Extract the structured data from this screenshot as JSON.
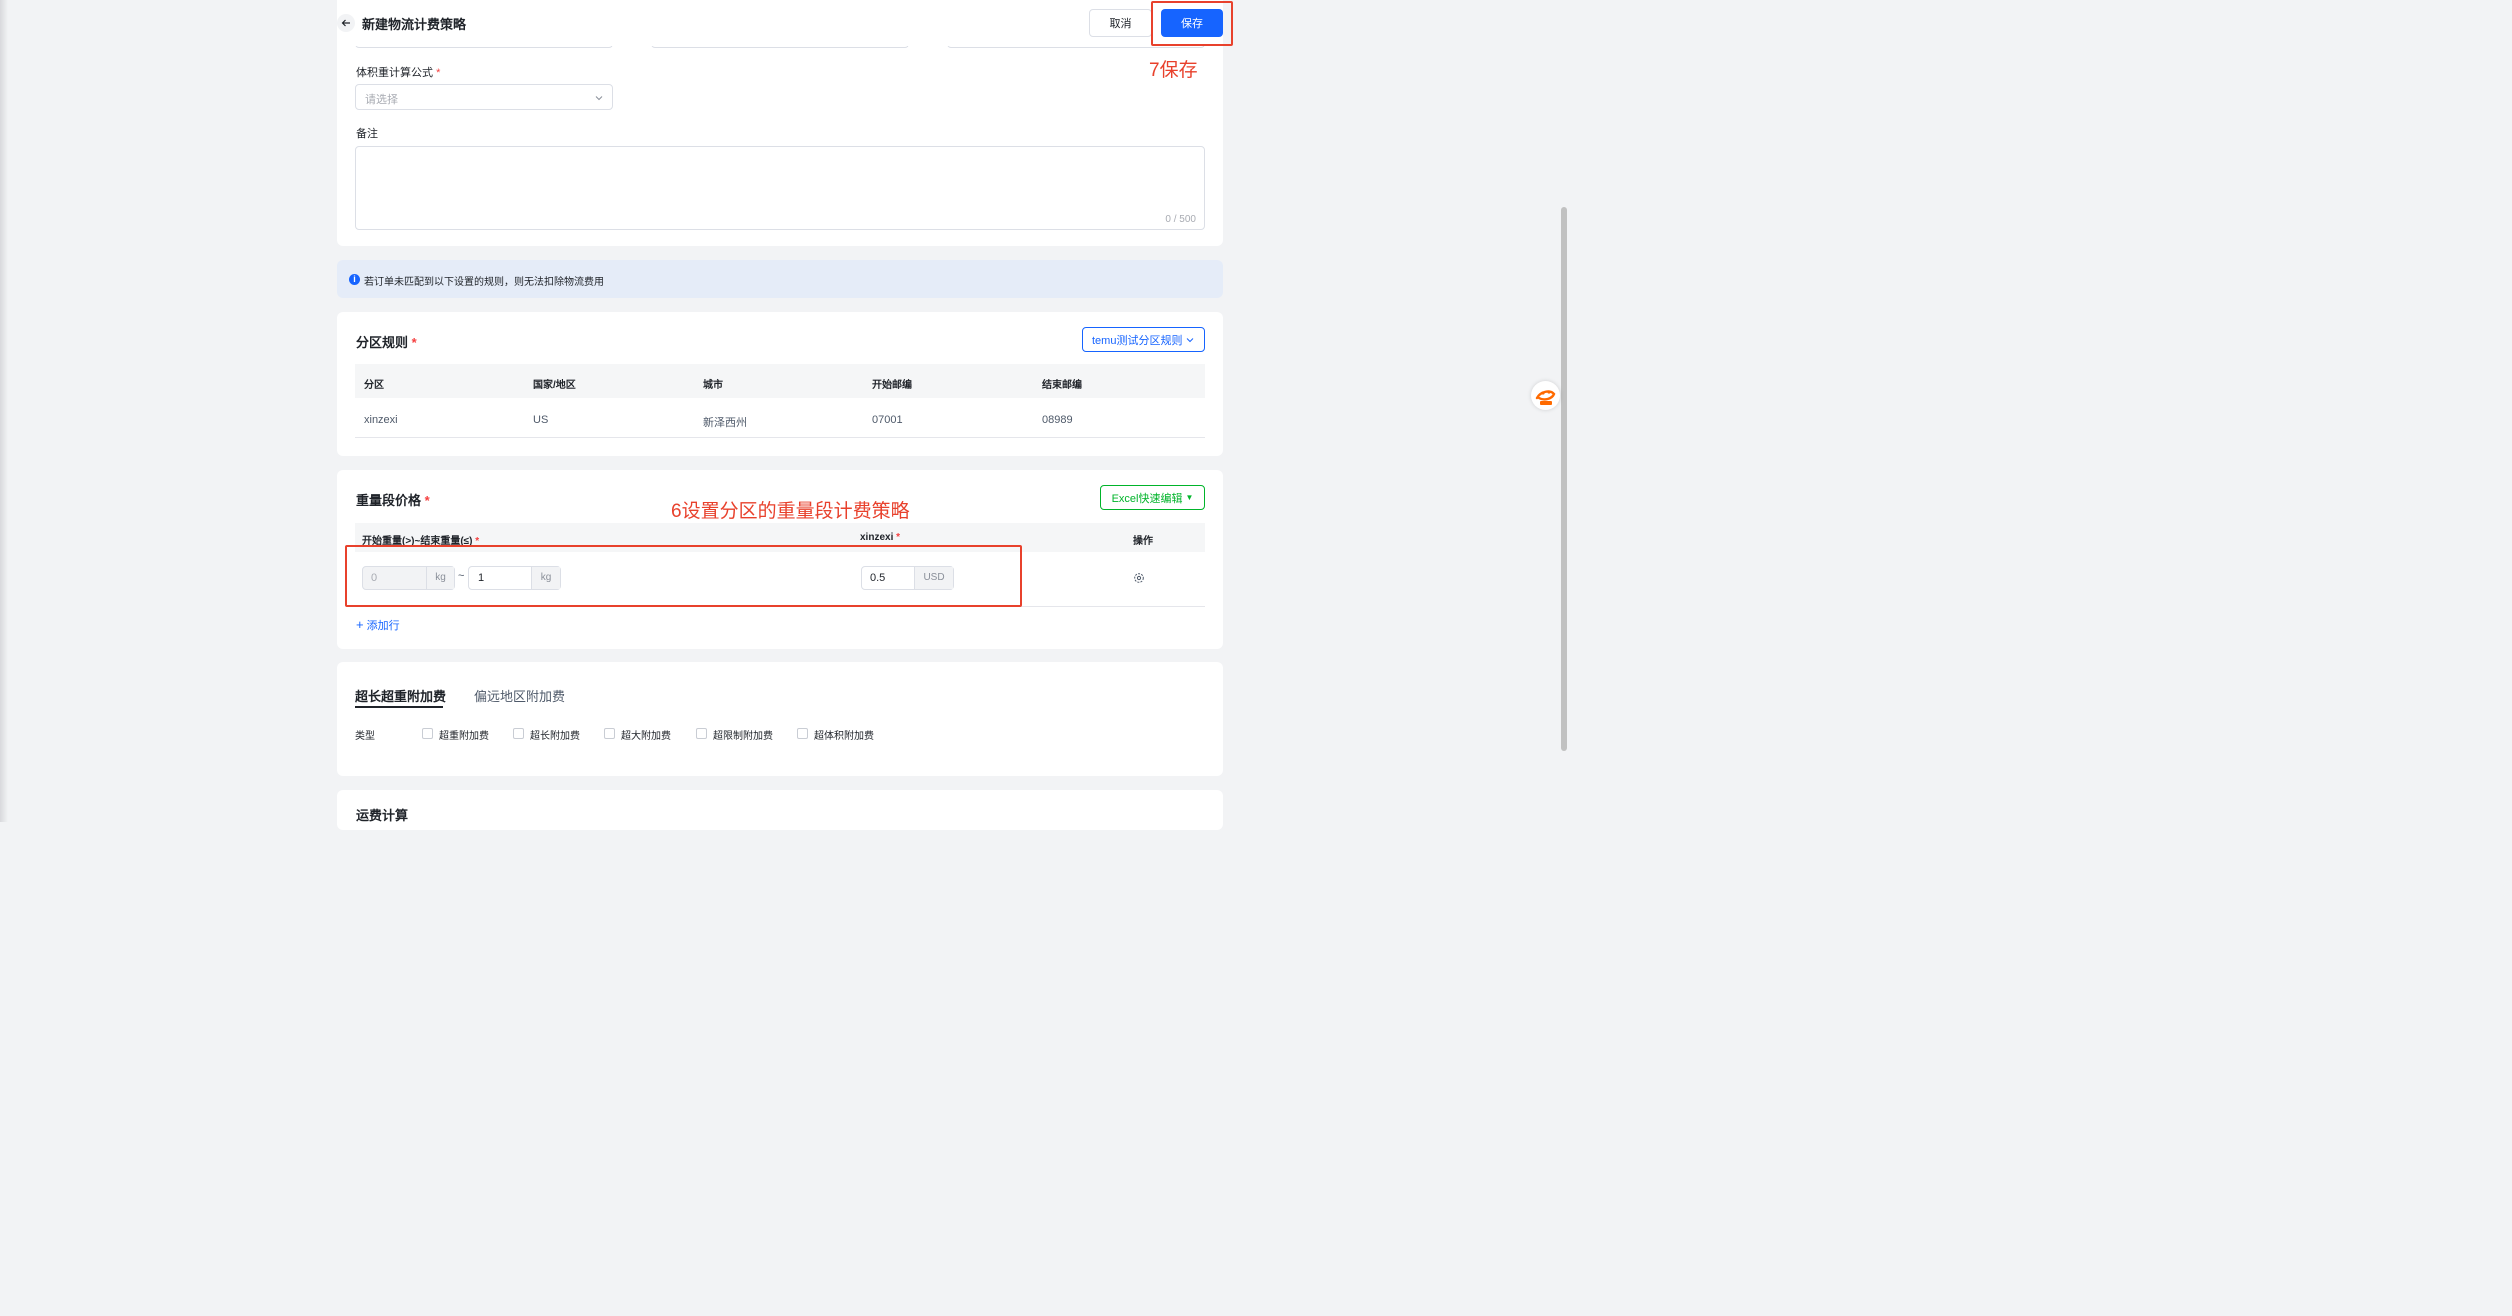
{
  "header": {
    "back_icon": "arrow-left-icon",
    "title": "新建物流计费策略",
    "cancel_label": "取消",
    "save_label": "保存"
  },
  "annotations": {
    "save_step": "7保存",
    "weight_step": "6设置分区的重量段计费策略"
  },
  "form": {
    "formula_label": "体积重计算公式",
    "formula_placeholder": "请选择",
    "remark_label": "备注",
    "remark_counter": "0 / 500"
  },
  "notice": {
    "icon": "info-icon",
    "text": "若订单未匹配到以下设置的规则，则无法扣除物流费用"
  },
  "zone_rules": {
    "title": "分区规则",
    "selected": "temu测试分区规则",
    "columns": [
      "分区",
      "国家/地区",
      "城市",
      "开始邮编",
      "结束邮编"
    ],
    "rows": [
      [
        "xinzexi",
        "US",
        "新泽西州",
        "07001",
        "08989"
      ]
    ]
  },
  "weight_price": {
    "title": "重量段价格",
    "excel_button": "Excel快速编辑",
    "col_range": "开始重量(>)~结束重量(≤)",
    "col_zone": "xinzexi",
    "col_action": "操作",
    "row": {
      "start": "0",
      "end": "1",
      "unit": "kg",
      "sep": "~",
      "price": "0.5",
      "currency": "USD",
      "action_icon": "settings-icon"
    },
    "add_row": "添加行"
  },
  "surcharge": {
    "tabs": [
      "超长超重附加费",
      "偏远地区附加费"
    ],
    "type_label": "类型",
    "options": [
      "超重附加费",
      "超长附加费",
      "超大附加费",
      "超限制附加费",
      "超体积附加费"
    ]
  },
  "freight": {
    "title": "运费计算"
  },
  "side_badge": {
    "icon": "1688-logo-icon"
  }
}
